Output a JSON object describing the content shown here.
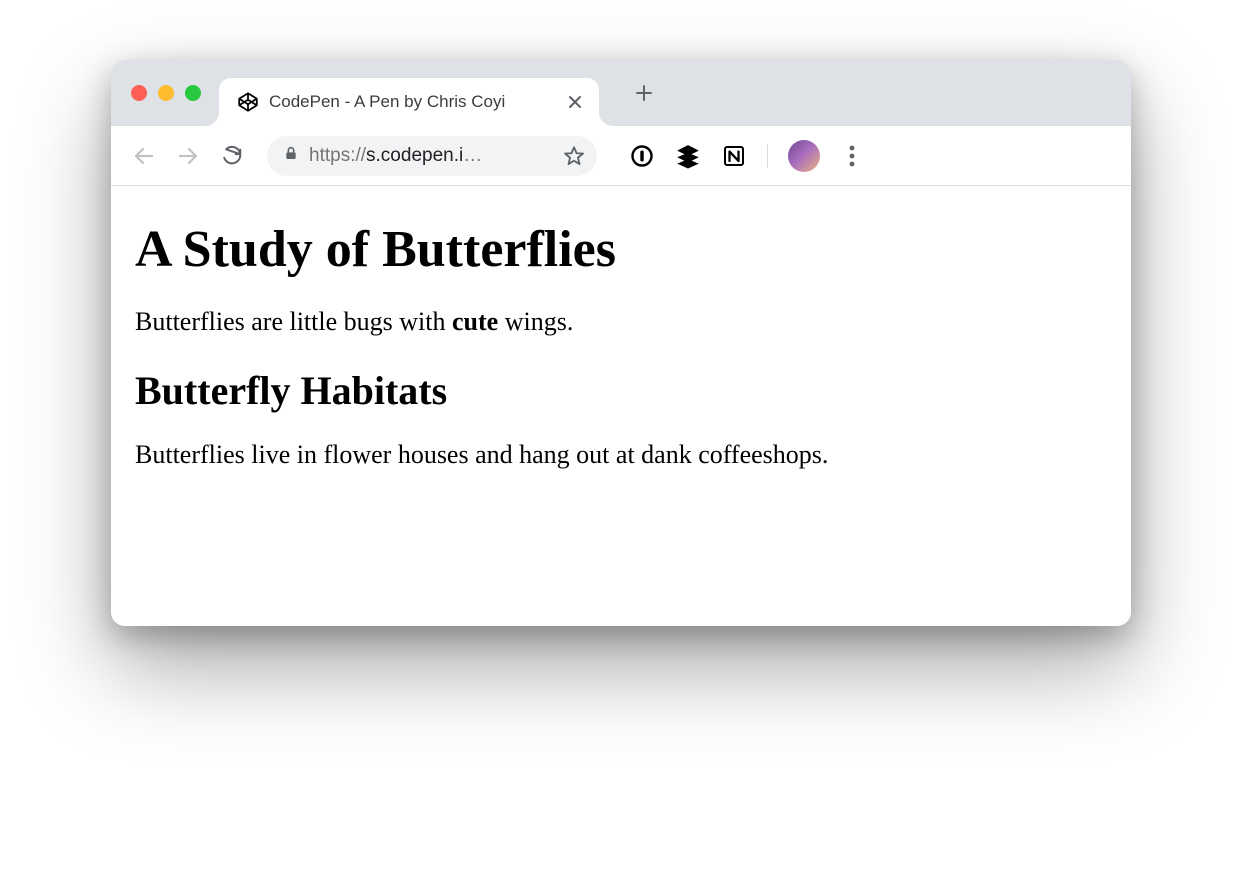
{
  "chrome": {
    "tab_title": "CodePen - A Pen by Chris Coyi",
    "url_scheme": "https://",
    "url_host": "s.codepen.i",
    "url_suffix": "…"
  },
  "page": {
    "h1": "A Study of Butterflies",
    "p1_pre": "Butterflies are little bugs with ",
    "p1_bold": "cute",
    "p1_post": " wings.",
    "h2": "Butterfly Habitats",
    "p2": "Butterflies live in flower houses and hang out at dank coffeeshops."
  }
}
